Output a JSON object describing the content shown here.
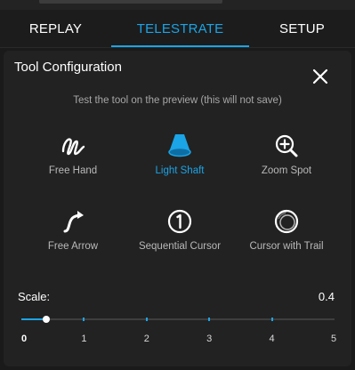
{
  "tabs": [
    {
      "label": "REPLAY",
      "active": false
    },
    {
      "label": "TELESTRATE",
      "active": true
    },
    {
      "label": "SETUP",
      "active": false
    }
  ],
  "panel": {
    "title": "Tool Configuration",
    "subtitle": "Test the tool on the preview (this will not save)"
  },
  "tools": [
    {
      "label": "Free Hand",
      "icon": "free-hand-icon",
      "selected": false
    },
    {
      "label": "Light Shaft",
      "icon": "light-shaft-icon",
      "selected": true
    },
    {
      "label": "Zoom Spot",
      "icon": "zoom-spot-icon",
      "selected": false
    },
    {
      "label": "Free Arrow",
      "icon": "free-arrow-icon",
      "selected": false
    },
    {
      "label": "Sequential Cursor",
      "icon": "sequential-cursor-icon",
      "selected": false
    },
    {
      "label": "Cursor with Trail",
      "icon": "cursor-with-trail-icon",
      "selected": false
    }
  ],
  "scale": {
    "label": "Scale:",
    "value": "0.4",
    "min": 0,
    "max": 5,
    "ticks": [
      "0",
      "1",
      "2",
      "3",
      "4",
      "5"
    ]
  },
  "colors": {
    "accent": "#1ba4e6",
    "background": "#1a1a1a",
    "panel": "#222222"
  }
}
